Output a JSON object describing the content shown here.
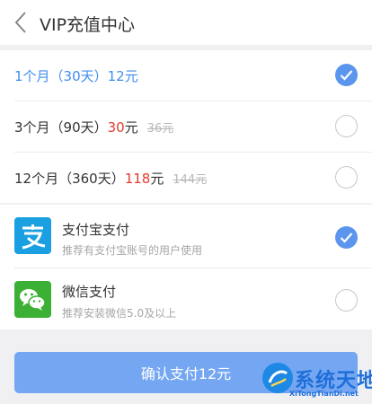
{
  "header": {
    "title": "VIP充值中心",
    "back_icon": "chevron-left-icon"
  },
  "plans": [
    {
      "label": "1个月（30天）",
      "price": "12元",
      "original": "",
      "selected": true
    },
    {
      "label": "3个月（90天）",
      "price": "30",
      "unit": "元",
      "original": "36元",
      "selected": false
    },
    {
      "label": "12个月（360天）",
      "price": "118",
      "unit": "元",
      "original": "144元",
      "selected": false
    }
  ],
  "payments": [
    {
      "title": "支付宝支付",
      "subtitle": "推荐有支付宝账号的用户使用",
      "icon": "alipay-icon",
      "selected": true
    },
    {
      "title": "微信支付",
      "subtitle": "推荐安装微信5.0及以上",
      "icon": "wechat-icon",
      "selected": false
    }
  ],
  "footer": {
    "confirm_label": "确认支付12元"
  },
  "watermark": {
    "title": "系统天地",
    "url": "XiTongTianDi.net"
  },
  "colors": {
    "accent": "#3d8ef0",
    "price_red": "#e63a2f",
    "radio_checked": "#5b95ee",
    "button": "#74a6f2",
    "alipay": "#1a9fe0",
    "wechat": "#3cb034"
  }
}
